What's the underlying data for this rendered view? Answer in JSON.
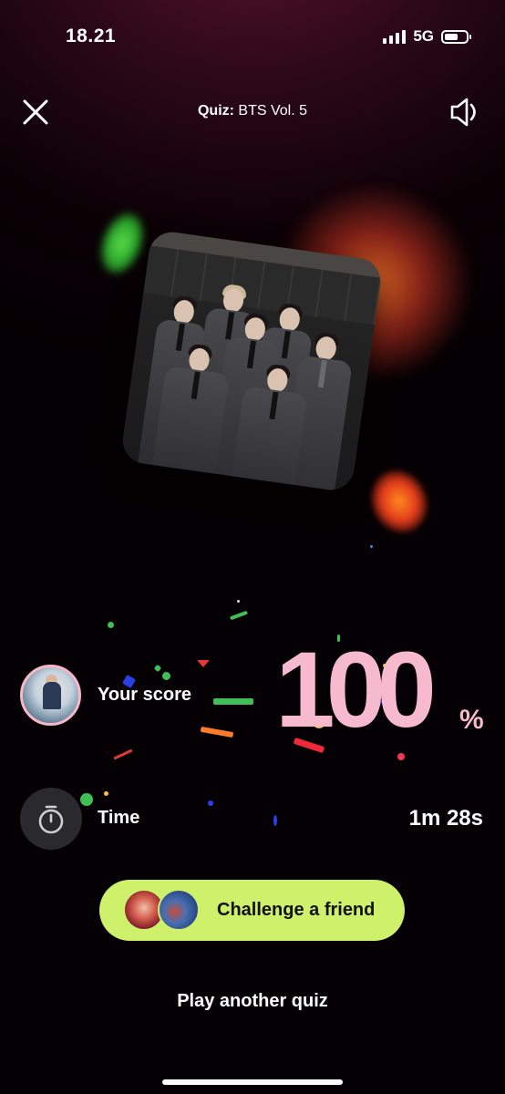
{
  "status_bar": {
    "time": "18.21",
    "network": "5G"
  },
  "header": {
    "title_prefix": "Quiz:",
    "title": "BTS Vol. 5",
    "close_icon": "close-icon",
    "sound_icon": "speaker-icon"
  },
  "score": {
    "label": "Your score",
    "value": "100",
    "unit": "%"
  },
  "time": {
    "label": "Time",
    "value": "1m 28s",
    "icon": "stopwatch-icon"
  },
  "challenge_button": {
    "label": "Challenge a friend"
  },
  "play_another": {
    "label": "Play another quiz"
  },
  "colors": {
    "accent_pink": "#f7b9cd",
    "accent_lime": "#cef06a",
    "background": "#0a0105"
  }
}
